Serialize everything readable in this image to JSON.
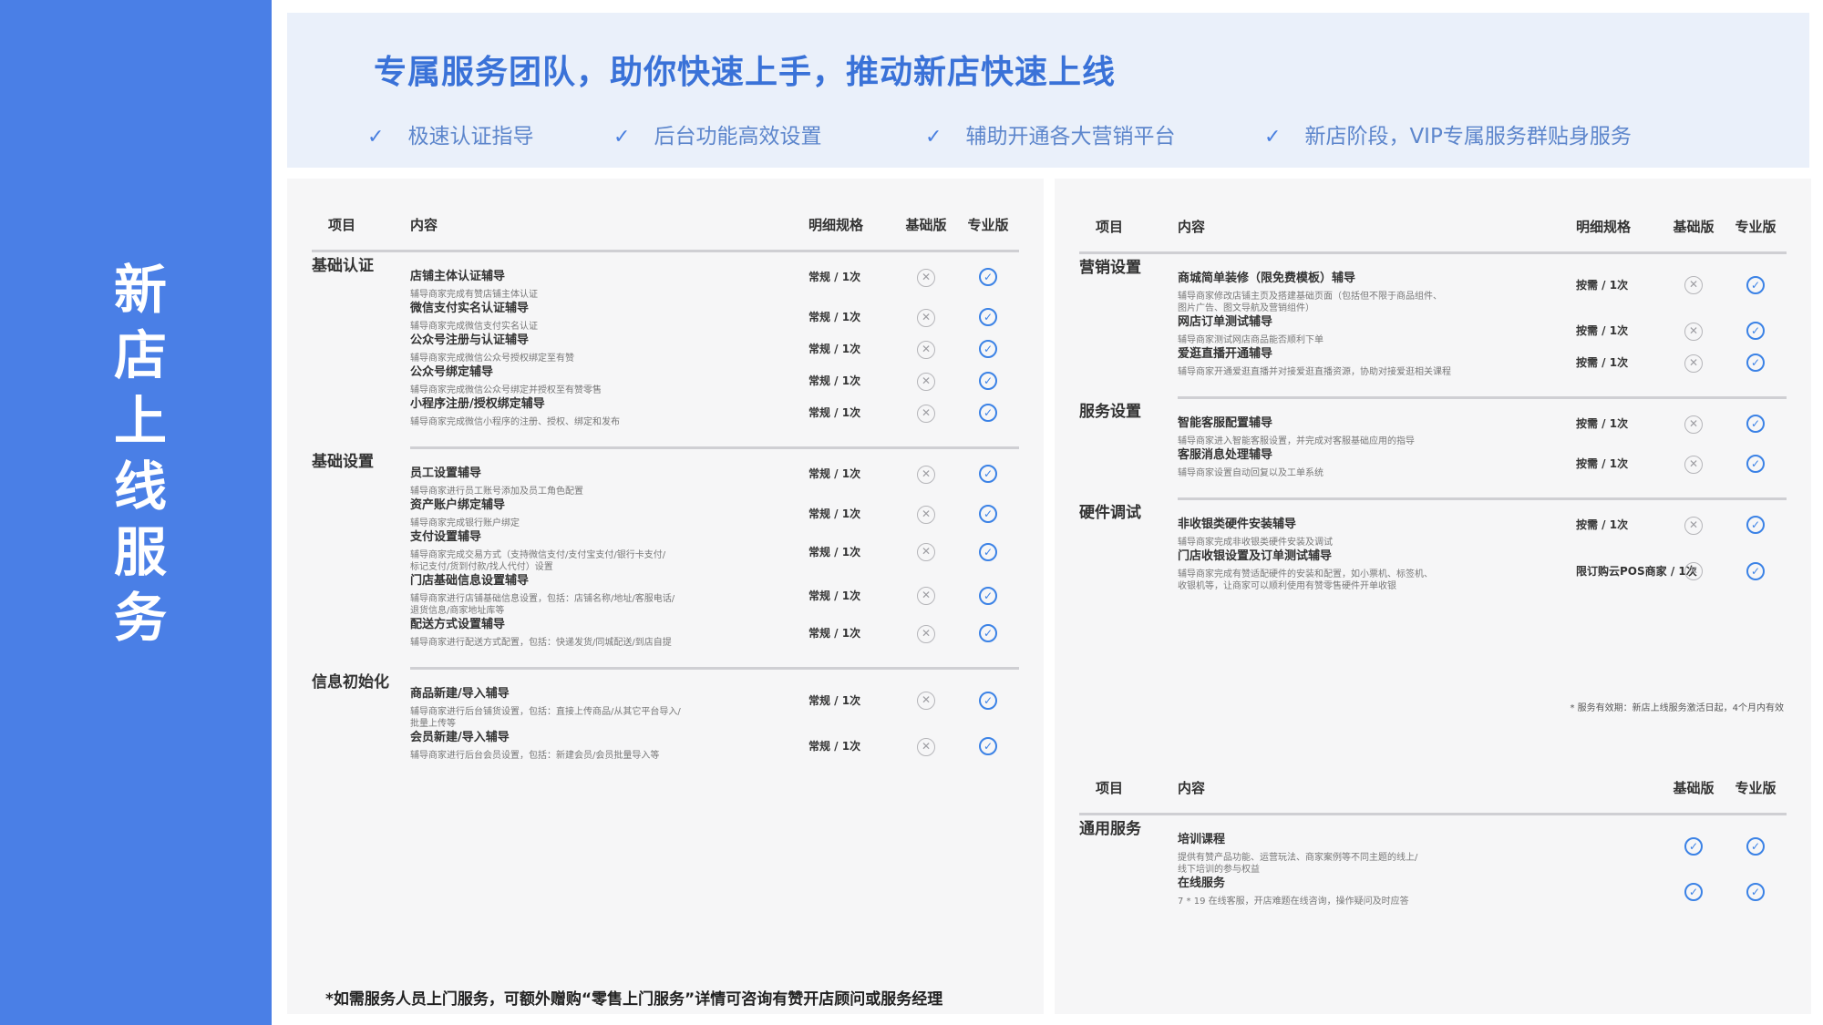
{
  "sidebar": {
    "title": "新店上线服务"
  },
  "banner": {
    "title": "专属服务团队，助你快速上手，推动新店快速上线",
    "points": [
      {
        "icon": "check-icon",
        "mark": "✓",
        "text": "极速认证指导"
      },
      {
        "icon": "check-icon",
        "mark": "✓",
        "text": "后台功能高效设置"
      },
      {
        "icon": "check-icon",
        "mark": "✓",
        "text": "辅助开通各大营销平台"
      },
      {
        "icon": "check-icon",
        "mark": "✓",
        "text": "新店阶段，VIP专属服务群贴身服务"
      }
    ]
  },
  "headers": {
    "project": "项目",
    "content": "内容",
    "spec": "明细规格",
    "basic": "基础版",
    "pro": "专业版"
  },
  "left_table": {
    "groups": [
      {
        "category": "基础认证",
        "items": [
          {
            "title": "店铺主体认证辅导",
            "desc": "辅导商家完成有赞店铺主体认证",
            "spec": "常规 / 1次",
            "basic": "cross",
            "pro": "check"
          },
          {
            "title": "微信支付实名认证辅导",
            "desc": "辅导商家完成微信支付实名认证",
            "spec": "常规 / 1次",
            "basic": "cross",
            "pro": "check"
          },
          {
            "title": "公众号注册与认证辅导",
            "desc": "辅导商家完成微信公众号授权绑定至有赞",
            "spec": "常规 / 1次",
            "basic": "cross",
            "pro": "check"
          },
          {
            "title": "公众号绑定辅导",
            "desc": "辅导商家完成微信公众号绑定并授权至有赞零售",
            "spec": "常规 / 1次",
            "basic": "cross",
            "pro": "check"
          },
          {
            "title": "小程序注册/授权绑定辅导",
            "desc": "辅导商家完成微信小程序的注册、授权、绑定和发布",
            "spec": "常规 / 1次",
            "basic": "cross",
            "pro": "check"
          }
        ]
      },
      {
        "category": "基础设置",
        "items": [
          {
            "title": "员工设置辅导",
            "desc": "辅导商家进行员工账号添加及员工角色配置",
            "spec": "常规 / 1次",
            "basic": "cross",
            "pro": "check"
          },
          {
            "title": "资产账户绑定辅导",
            "desc": "辅导商家完成银行账户绑定",
            "spec": "常规 / 1次",
            "basic": "cross",
            "pro": "check"
          },
          {
            "title": "支付设置辅导",
            "desc": "辅导商家完成交易方式（支持微信支付/支付宝支付/银行卡支付/\n标记支付/货到付款/找人代付）设置",
            "spec": "常规 / 1次",
            "basic": "cross",
            "pro": "check"
          },
          {
            "title": "门店基础信息设置辅导",
            "desc": "辅导商家进行店铺基础信息设置，包括：店铺名称/地址/客服电话/\n退货信息/商家地址库等",
            "spec": "常规 / 1次",
            "basic": "cross",
            "pro": "check"
          },
          {
            "title": "配送方式设置辅导",
            "desc": "辅导商家进行配送方式配置，包括：快递发货/同城配送/到店自提",
            "spec": "常规 / 1次",
            "basic": "cross",
            "pro": "check"
          }
        ]
      },
      {
        "category": "信息初始化",
        "items": [
          {
            "title": "商品新建/导入辅导",
            "desc": "辅导商家进行后台铺货设置，包括：直接上传商品/从其它平台导入/\n批量上传等",
            "spec": "常规 / 1次",
            "basic": "cross",
            "pro": "check"
          },
          {
            "title": "会员新建/导入辅导",
            "desc": "辅导商家进行后台会员设置，包括：新建会员/会员批量导入等",
            "spec": "常规 / 1次",
            "basic": "cross",
            "pro": "check"
          }
        ]
      }
    ],
    "footnote": "*如需服务人员上门服务，可额外赠购“零售上门服务”详情可咨询有赞开店顾问或服务经理"
  },
  "right_table": {
    "groups": [
      {
        "category": "营销设置",
        "items": [
          {
            "title": "商城简单装修（限免费模板）辅导",
            "desc": "辅导商家修改店铺主页及搭建基础页面（包括但不限于商品组件、\n图片广告、图文导航及营销组件）",
            "spec": "按需 / 1次",
            "basic": "cross",
            "pro": "check"
          },
          {
            "title": "网店订单测试辅导",
            "desc": "辅导商家测试网店商品能否顺利下单",
            "spec": "按需 / 1次",
            "basic": "cross",
            "pro": "check"
          },
          {
            "title": "爱逛直播开通辅导",
            "desc": "辅导商家开通爱逛直播并对接爱逛直播资源，协助对接爱逛相关课程",
            "spec": "按需 / 1次",
            "basic": "cross",
            "pro": "check"
          }
        ]
      },
      {
        "category": "服务设置",
        "items": [
          {
            "title": "智能客服配置辅导",
            "desc": "辅导商家进入智能客服设置，并完成对客服基础应用的指导",
            "spec": "按需 / 1次",
            "basic": "cross",
            "pro": "check"
          },
          {
            "title": "客服消息处理辅导",
            "desc": "辅导商家设置自动回复以及工单系统",
            "spec": "按需 / 1次",
            "basic": "cross",
            "pro": "check"
          }
        ]
      },
      {
        "category": "硬件调试",
        "items": [
          {
            "title": "非收银类硬件安装辅导",
            "desc": "辅导商家完成非收银类硬件安装及调试",
            "spec": "按需 / 1次",
            "basic": "cross",
            "pro": "check"
          },
          {
            "title": "门店收银设置及订单测试辅导",
            "desc": "辅导商家完成有赞适配硬件的安装和配置，如小票机、标签机、\n收银机等，让商家可以顺利使用有赞零售硬件开单收银",
            "spec": "限订购云POS商家 / 1次",
            "basic": "cross",
            "pro": "check"
          }
        ]
      }
    ],
    "validity_note": "* 服务有效期：新店上线服务激活日起，4个月内有效"
  },
  "general_table": {
    "groups": [
      {
        "category": "通用服务",
        "items": [
          {
            "title": "培训课程",
            "desc": "提供有赞产品功能、运营玩法、商家案例等不同主题的线上/\n线下培训的参与权益",
            "spec": "",
            "basic": "check",
            "pro": "check"
          },
          {
            "title": "在线服务",
            "desc": "7 * 19 在线客服，开店难题在线咨询，操作疑问及时应答",
            "spec": "",
            "basic": "check",
            "pro": "check"
          }
        ]
      }
    ]
  },
  "marks": {
    "cross": "✕",
    "check": "✓"
  },
  "colors": {
    "sidebar": "#4a7fe6",
    "accent": "#3b82e6",
    "banner_bg": "#eaf0fa"
  }
}
